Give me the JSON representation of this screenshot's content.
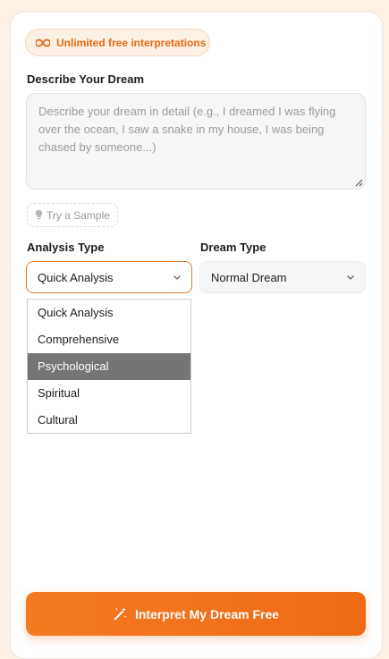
{
  "badge": {
    "icon": "infinity-icon",
    "text": "Unlimited free interpretations"
  },
  "dream_input": {
    "label": "Describe Your Dream",
    "value": "",
    "placeholder": "Describe your dream in detail (e.g., I dreamed I was flying over the ocean, I saw a snake in my house, I was being chased by someone...)"
  },
  "sample_button": {
    "icon": "lightbulb-icon",
    "label": "Try a Sample"
  },
  "analysis_type": {
    "label": "Analysis Type",
    "selected": "Quick Analysis",
    "options": [
      "Quick Analysis",
      "Comprehensive",
      "Psychological",
      "Spiritual",
      "Cultural"
    ],
    "highlighted": "Psychological"
  },
  "dream_type": {
    "label": "Dream Type",
    "selected": "Normal Dream"
  },
  "submit_button": {
    "icon": "magic-wand-icon",
    "label": "Interpret My Dream Free"
  },
  "colors": {
    "accent": "#f07020",
    "badge_bg": "#fdf0e4",
    "highlight": "#757575"
  }
}
